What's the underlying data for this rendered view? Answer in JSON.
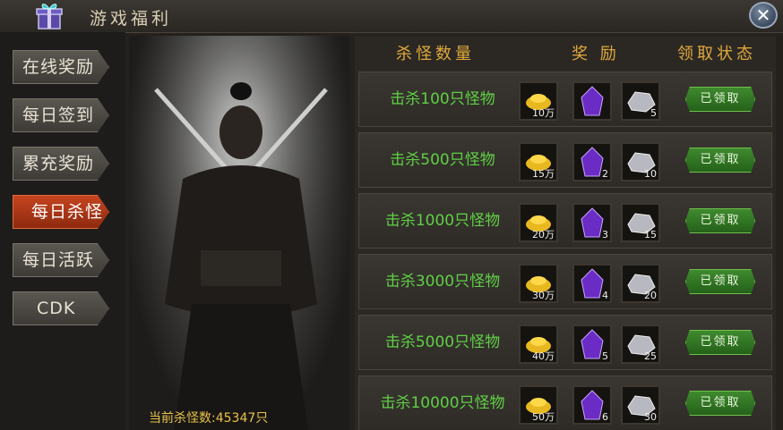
{
  "window": {
    "title": "游戏福利",
    "close_label": "✕"
  },
  "nav": {
    "items": [
      {
        "label": "在线奖励",
        "active": false
      },
      {
        "label": "每日签到",
        "active": false
      },
      {
        "label": "累充奖励",
        "active": false
      },
      {
        "label": "每日杀怪",
        "active": true
      },
      {
        "label": "每日活跃",
        "active": false
      },
      {
        "label": "CDK",
        "active": false
      }
    ]
  },
  "portrait": {
    "kill_count": "当前杀怪数:45347只"
  },
  "table": {
    "headers": {
      "condition": "杀怪数量",
      "reward": "奖 励",
      "status": "领取状态"
    },
    "rows": [
      {
        "condition": "击杀100只怪物",
        "gold": "10万",
        "gem": "",
        "ore": "5",
        "status": "已领取"
      },
      {
        "condition": "击杀500只怪物",
        "gold": "15万",
        "gem": "2",
        "ore": "10",
        "status": "已领取"
      },
      {
        "condition": "击杀1000只怪物",
        "gold": "20万",
        "gem": "3",
        "ore": "15",
        "status": "已领取"
      },
      {
        "condition": "击杀3000只怪物",
        "gold": "30万",
        "gem": "4",
        "ore": "20",
        "status": "已领取"
      },
      {
        "condition": "击杀5000只怪物",
        "gold": "40万",
        "gem": "5",
        "ore": "25",
        "status": "已领取"
      },
      {
        "condition": "击杀10000只怪物",
        "gold": "50万",
        "gem": "6",
        "ore": "30",
        "status": "已领取"
      }
    ]
  },
  "colors": {
    "accent_orange": "#c5441e",
    "condition_green": "#5fd045",
    "header_gold": "#e0a83c"
  }
}
